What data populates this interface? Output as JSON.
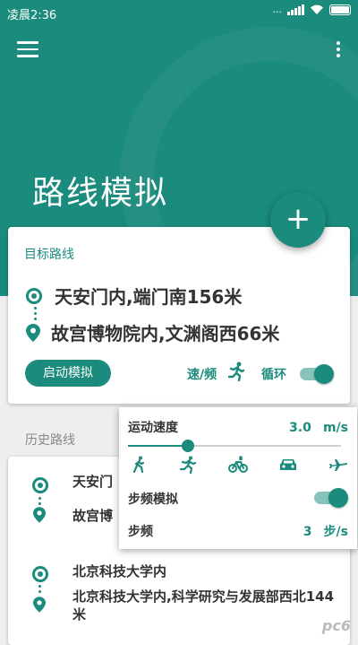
{
  "status_bar": {
    "time": "凌晨2:36",
    "net": "..."
  },
  "header": {
    "title": "路线模拟"
  },
  "fab": {
    "label": "+"
  },
  "route_card": {
    "label": "目标路线",
    "origin": "天安门内,端门南156米",
    "destination": "故宫博物院内,文渊阁西66米",
    "start_button": "启动模拟",
    "speed_link": "速/频",
    "loop_label": "循环",
    "loop_on": true
  },
  "history": {
    "label": "历史路线",
    "items": [
      {
        "origin": "天安门",
        "destination": "故宫博"
      },
      {
        "origin": "北京科技大学内",
        "destination": "北京科技大学内,科学研究与发展部西北144米"
      }
    ]
  },
  "speed_popup": {
    "speed_label": "运动速度",
    "speed_value": "3.0",
    "speed_unit": "m/s",
    "speed_level": 0.28,
    "modes": [
      "walk-icon",
      "run-icon",
      "bike-icon",
      "car-icon",
      "plane-icon"
    ],
    "cadence_label": "步频模拟",
    "cadence_on": true,
    "step_label": "步频",
    "step_value": "3",
    "step_unit": "步/s"
  },
  "watermark": "pc6",
  "colors": {
    "primary": "#1a8b7c",
    "toggle_track": "#87c3bb"
  }
}
